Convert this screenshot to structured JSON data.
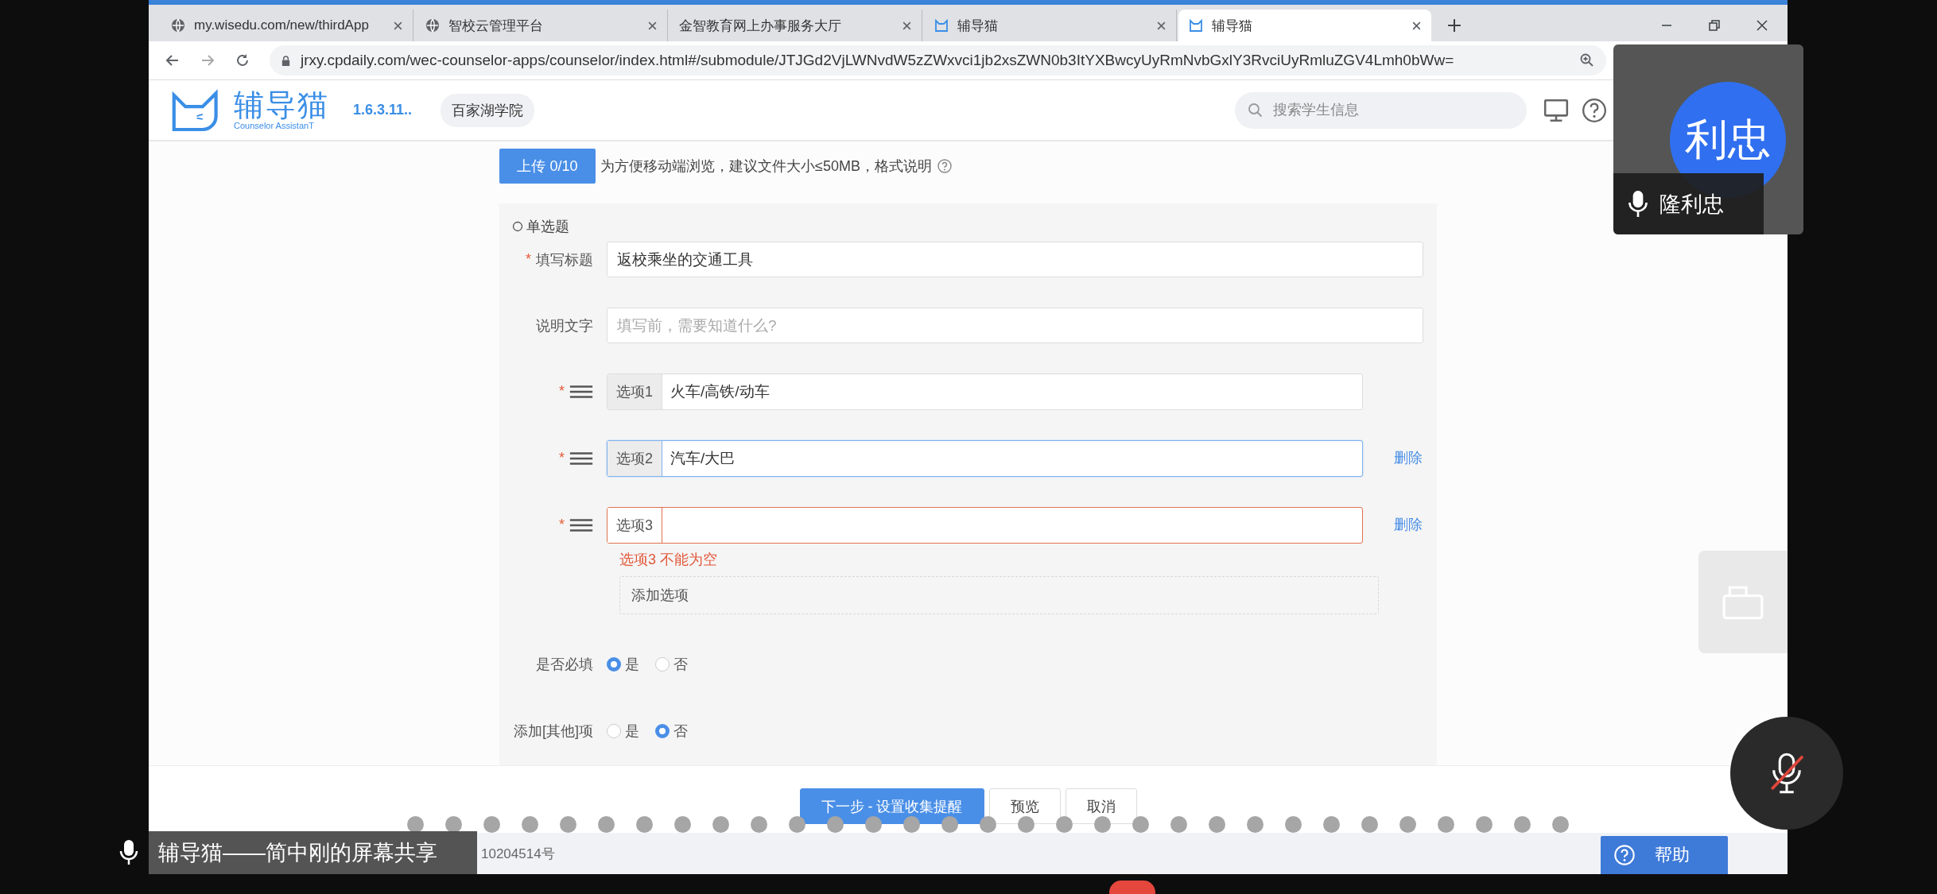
{
  "browser": {
    "tabs": [
      {
        "title": "my.wisedu.com/new/thirdApp",
        "kind": "globe",
        "selected": false
      },
      {
        "title": "智校云管理平台",
        "kind": "globe",
        "selected": false
      },
      {
        "title": "金智教育网上办事服务大厅",
        "kind": "plain",
        "selected": false
      },
      {
        "title": "辅导猫",
        "kind": "app",
        "selected": false
      },
      {
        "title": "辅导猫",
        "kind": "app",
        "selected": true
      }
    ],
    "url": "jrxy.cpdaily.com/wec-counselor-apps/counselor/index.html#/submodule/JTJGd2VjLWNvdW5zZWxvci1jb2xsZWN0b3ItYXBwcyUyRmNvbGxlY3RvciUyRmluZGV4Lmh0bWw="
  },
  "header": {
    "app_name": "辅导猫",
    "app_subtitle": "Counselor AssistanT",
    "version": "1.6.3.11..",
    "college": "百家湖学院",
    "search": {
      "placeholder": "搜索学生信息"
    }
  },
  "upload": {
    "button": "上传 0/10",
    "hint": "为方便移动端浏览，建议文件大小≤50MB，格式说明"
  },
  "question": {
    "type_label": "单选题",
    "fields": [
      {
        "label": "填写标题",
        "required_mark": "*",
        "value": "返校乘坐的交通工具"
      },
      {
        "label": "说明文字",
        "placeholder": "填写前，需要知道什么?"
      }
    ],
    "options": [
      {
        "prefix": "选项1",
        "value": "火车/高铁/动车",
        "required_mark": "*",
        "focused": false,
        "invalid": false
      },
      {
        "prefix": "选项2",
        "value": "汽车/大巴",
        "required_mark": "*",
        "focused": true,
        "invalid": false,
        "delete": "删除"
      },
      {
        "prefix": "选项3",
        "required_mark": "*",
        "focused": false,
        "invalid": true,
        "delete": "删除",
        "error": "选项3 不能为空"
      }
    ],
    "add_option": "添加选项",
    "radio_groups": [
      {
        "label": "是否必填",
        "choices": [
          {
            "label": "是",
            "selected": true
          },
          {
            "label": "否",
            "selected": false
          }
        ]
      },
      {
        "label": "添加[其他]项",
        "choices": [
          {
            "label": "是",
            "selected": false
          },
          {
            "label": "否",
            "selected": true
          }
        ]
      }
    ]
  },
  "footer_buttons": [
    {
      "label": "下一步 - 设置收集提醒",
      "kind": "primary"
    },
    {
      "label": "预览",
      "kind": "default"
    },
    {
      "label": "取消",
      "kind": "default"
    }
  ],
  "footer_text": "10204514号",
  "meeting": {
    "avatar_text": "利忠",
    "name": "隆利忠",
    "share_caption": "辅导猫——简中刚的屏幕共享",
    "help": "帮助",
    "muted": true
  }
}
